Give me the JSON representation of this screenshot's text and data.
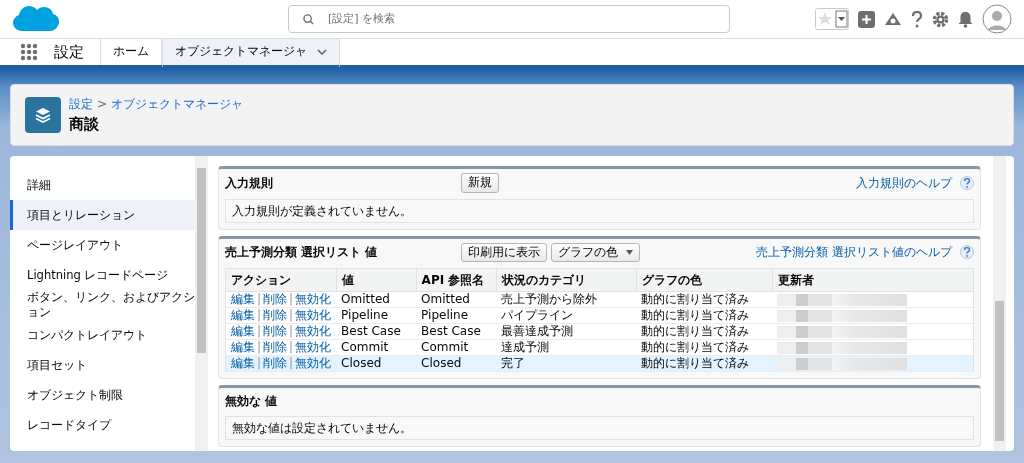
{
  "header": {
    "search_placeholder": "[設定] を検索"
  },
  "nav": {
    "app_name": "設定",
    "tabs": [
      {
        "label": "ホーム",
        "selected": false
      },
      {
        "label": "オブジェクトマネージャ",
        "selected": true
      }
    ]
  },
  "page_header": {
    "breadcrumb": [
      {
        "label": "設定"
      },
      {
        "label": "オブジェクトマネージャ"
      }
    ],
    "breadcrumb_separator": ">",
    "title": "商談"
  },
  "sidebar": {
    "items": [
      {
        "label": "詳細",
        "selected": false
      },
      {
        "label": "項目とリレーション",
        "selected": true
      },
      {
        "label": "ページレイアウト",
        "selected": false
      },
      {
        "label": "Lightning レコードページ",
        "selected": false
      },
      {
        "label": "ボタン、リンク、およびアクション",
        "selected": false
      },
      {
        "label": "コンパクトレイアウト",
        "selected": false
      },
      {
        "label": "項目セット",
        "selected": false
      },
      {
        "label": "オブジェクト制限",
        "selected": false
      },
      {
        "label": "レコードタイプ",
        "selected": false
      }
    ]
  },
  "validation_rules": {
    "title": "入力規則",
    "buttons": [
      "新規"
    ],
    "help_link": "入力規則のヘルプ",
    "empty_message": "入力規則が定義されていません。"
  },
  "picklist": {
    "title": "売上予測分類 選択リスト 値",
    "buttons": [
      "印刷用に表示"
    ],
    "dropdown": "グラフの色",
    "help_link": "売上予測分類 選択リスト値のヘルプ",
    "table": {
      "columns": [
        "アクション",
        "値",
        "API 参照名",
        "状況のカテゴリ",
        "グラフの色",
        "更新者"
      ],
      "action_separator": "|",
      "rows": [
        {
          "actions": [
            "編集",
            "削除",
            "無効化"
          ],
          "value": "Omitted",
          "api_name": "Omitted",
          "category": "売上予測から除外",
          "chart_color": "動的に割り当て済み",
          "selected": false
        },
        {
          "actions": [
            "編集",
            "削除",
            "無効化"
          ],
          "value": "Pipeline",
          "api_name": "Pipeline",
          "category": "パイプライン",
          "chart_color": "動的に割り当て済み",
          "selected": false
        },
        {
          "actions": [
            "編集",
            "削除",
            "無効化"
          ],
          "value": "Best Case",
          "api_name": "Best Case",
          "category": "最善達成予測",
          "chart_color": "動的に割り当て済み",
          "selected": false
        },
        {
          "actions": [
            "編集",
            "削除",
            "無効化"
          ],
          "value": "Commit",
          "api_name": "Commit",
          "category": "達成予測",
          "chart_color": "動的に割り当て済み",
          "selected": false
        },
        {
          "actions": [
            "編集",
            "削除",
            "無効化"
          ],
          "value": "Closed",
          "api_name": "Closed",
          "category": "完了",
          "chart_color": "動的に割り当て済み",
          "selected": true
        }
      ]
    }
  },
  "inactive_values": {
    "title": "無効な 値",
    "empty_message": "無効な値は設定されていません。"
  }
}
